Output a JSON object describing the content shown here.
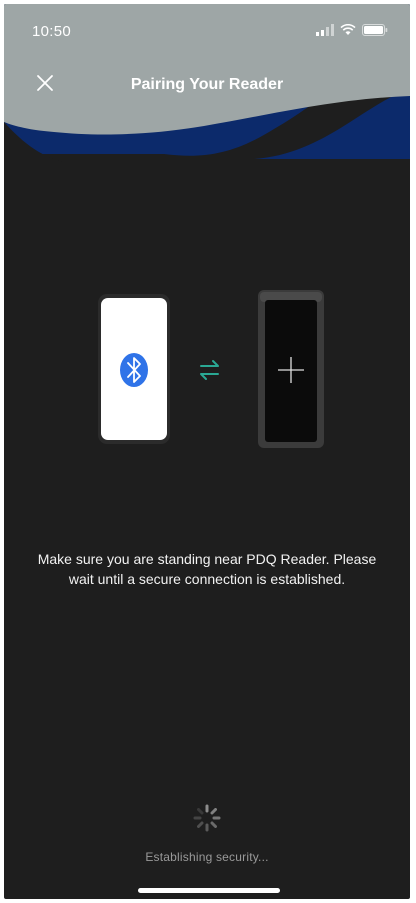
{
  "status_bar": {
    "time": "10:50"
  },
  "header": {
    "title": "Pairing Your Reader",
    "close_icon": "close-icon"
  },
  "illustration": {
    "phone_icon": "bluetooth-icon",
    "link_icon": "swap-arrows-icon",
    "reader_icon": "plus-icon"
  },
  "message": "Make sure you are standing near PDQ Reader. Please wait until a secure connection is established.",
  "status": {
    "text": "Establishing security..."
  },
  "colors": {
    "background": "#1e1e1e",
    "header_gray": "#9ea6a6",
    "header_navy": "#0c2a6b",
    "bluetooth_blue": "#2f73e8",
    "arrow_teal": "#2aa894"
  }
}
